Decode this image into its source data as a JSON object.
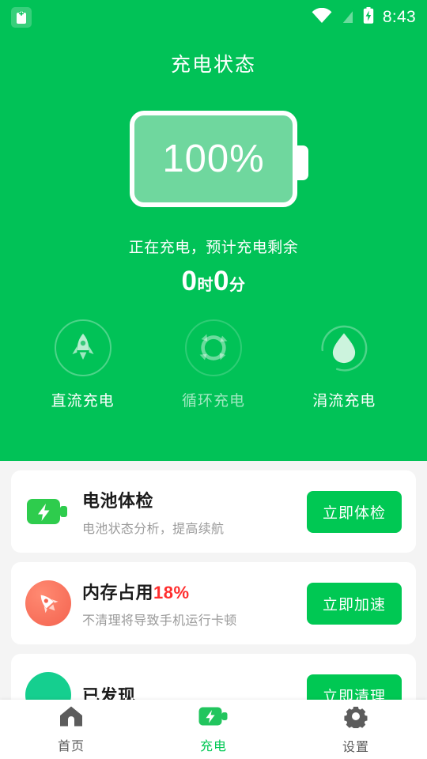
{
  "statusbar": {
    "time": "8:43",
    "icons": [
      "clipboard-icon",
      "wifi-icon",
      "signal-off-icon",
      "battery-charging-icon"
    ]
  },
  "header": {
    "title": "充电状态",
    "battery": {
      "percent_label": "100%",
      "percent_value": 100,
      "fill_color": "#6fd79e",
      "border_color": "#ffffff"
    },
    "charge_status_text": "正在充电，预计充电剩余",
    "remaining": {
      "hours": "0",
      "hours_unit": "时",
      "minutes": "0",
      "minutes_unit": "分"
    },
    "background_color": "#01c257",
    "modes": [
      {
        "label": "直流充电",
        "icon": "rocket-icon",
        "state": "active"
      },
      {
        "label": "循环充电",
        "icon": "recycle-icon",
        "state": "inactive"
      },
      {
        "label": "涓流充电",
        "icon": "water-drop-icon",
        "state": "active"
      }
    ]
  },
  "cards": [
    {
      "icon": "battery-bolt-icon",
      "title": "电池体检",
      "subtitle": "电池状态分析，提高续航",
      "button": "立即体检"
    },
    {
      "icon": "rocket-icon",
      "title_prefix": "内存占用",
      "title_highlight": "18%",
      "subtitle": "不清理将导致手机运行卡顿",
      "button": "立即加速",
      "highlight_color": "#ff2d2d"
    },
    {
      "icon": "app-circle-icon",
      "title": "已发现",
      "button": "立即清理"
    }
  ],
  "bottomnav": {
    "items": [
      {
        "label": "首页",
        "icon": "home-icon",
        "active": false
      },
      {
        "label": "充电",
        "icon": "battery-bolt-icon",
        "active": true
      },
      {
        "label": "设置",
        "icon": "gear-icon",
        "active": false
      }
    ]
  },
  "colors": {
    "brand_green": "#01c257",
    "button_green": "#00c853",
    "page_bg": "#f4f4f4",
    "alert_red": "#ff2d2d"
  }
}
